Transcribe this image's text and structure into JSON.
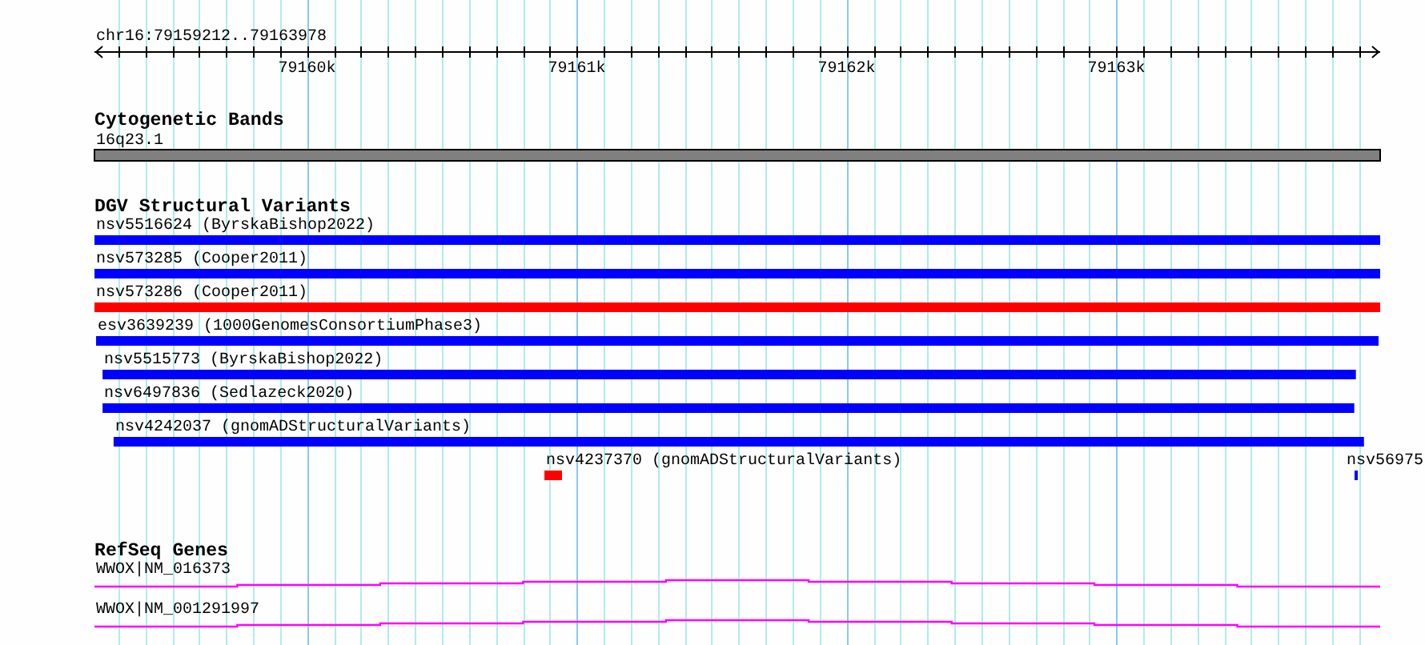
{
  "region": {
    "label": "chr16:79159212..79163978"
  },
  "ruler": {
    "ticks": [
      {
        "label": "79160k"
      },
      {
        "label": "79161k"
      },
      {
        "label": "79162k"
      },
      {
        "label": "79163k"
      }
    ]
  },
  "cytogenetic_bands": {
    "title": "Cytogenetic Bands",
    "bands": [
      {
        "label": "16q23.1"
      }
    ]
  },
  "dgv_structural_variants": {
    "title": "DGV Structural Variants",
    "features": [
      {
        "label": "nsv5516624 (ByrskaBishop2022)",
        "color": "#0000ff"
      },
      {
        "label": "nsv573285 (Cooper2011)",
        "color": "#0000ff"
      },
      {
        "label": "nsv573286 (Cooper2011)",
        "color": "#ff0000"
      },
      {
        "label": "esv3639239 (1000GenomesConsortiumPhase3)",
        "color": "#0000ff"
      },
      {
        "label": "nsv5515773 (ByrskaBishop2022)",
        "color": "#0000ff"
      },
      {
        "label": "nsv6497836 (Sedlazeck2020)",
        "color": "#0000ff"
      },
      {
        "label": "nsv4242037 (gnomADStructuralVariants)",
        "color": "#0000ff"
      },
      {
        "label": "nsv4237370 (gnomADStructuralVariants)",
        "color": "#ff0000"
      },
      {
        "label": "nsv56975",
        "color": "#0000ff"
      }
    ]
  },
  "refseq_genes": {
    "title": "RefSeq Genes",
    "genes": [
      {
        "label": "WWOX|NM_016373"
      },
      {
        "label": "WWOX|NM_001291997"
      }
    ]
  }
}
